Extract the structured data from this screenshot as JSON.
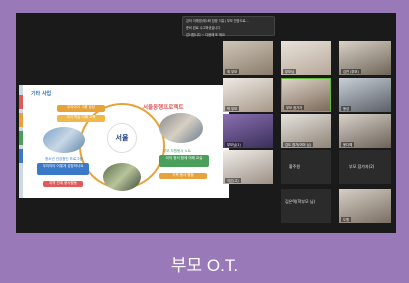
{
  "chat": {
    "line1": "강아 이예영(제1화 참방 이유) 부모 안방으로...",
    "line2": "준비 완료 수고하셨습니다",
    "line3": "감사합니다 ~ 다음에 또 봐요"
  },
  "slide": {
    "title": "기타 사업",
    "center_logo": "서울",
    "top_right_title": "서울동행프로젝트",
    "left_box_1": "우리아이 그룹 상담",
    "left_box_2": "자녀 학습 이해 교육",
    "left_label_bottom": "청소년 건강증진 프로그램",
    "left_box_bottom": "우리아이 어떻게 성장하나요",
    "right_label_bottom": "부모 자원봉사 노트",
    "right_box_bottom": "아이 정서 함께 이해 교실",
    "bottom_box_left": "지역 연계 봉사활동",
    "bottom_box_right": "가족 봉사 활동"
  },
  "participants": [
    {
      "name": "최 부모"
    },
    {
      "name": "부모님"
    },
    {
      "name": "김연 (부모)"
    },
    {
      "name": "박 부모"
    },
    {
      "name": "부모 참가자"
    },
    {
      "name": "윤성"
    },
    {
      "name": "부모님(1)"
    },
    {
      "name": "김도 참가(어머 님)"
    },
    {
      "name": "윤다예"
    },
    {
      "name": "이은(고)"
    },
    {
      "name": "황주원"
    },
    {
      "name": "부모 참가자(2)"
    },
    {
      "name": "김은택(학부모 님)"
    },
    {
      "name": "도원"
    }
  ],
  "caption": "부모 O.T."
}
